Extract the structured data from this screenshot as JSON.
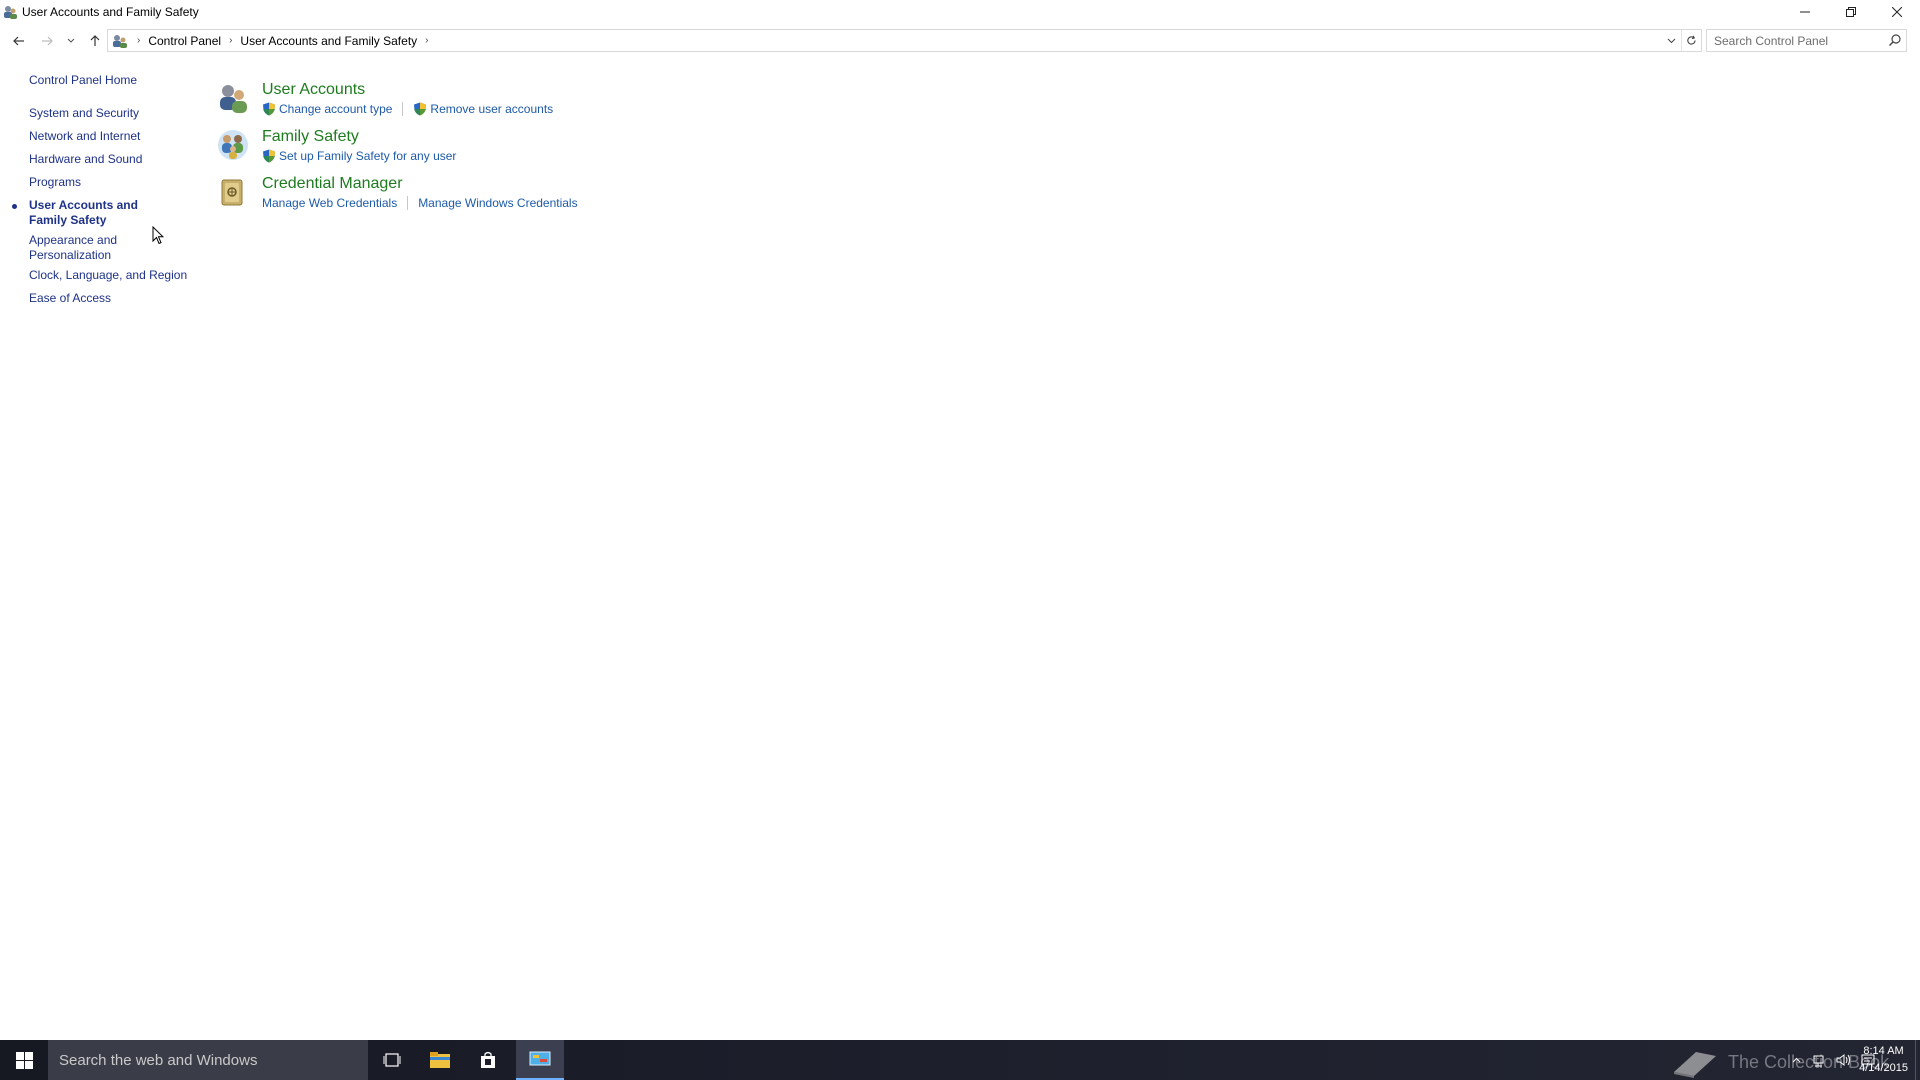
{
  "window": {
    "title": "User Accounts and Family Safety"
  },
  "address": {
    "crumbs": [
      "Control Panel",
      "User Accounts and Family Safety"
    ],
    "search_placeholder": "Search Control Panel"
  },
  "leftnav": {
    "home": "Control Panel Home",
    "items": [
      {
        "label": "System and Security"
      },
      {
        "label": "Network and Internet"
      },
      {
        "label": "Hardware and Sound"
      },
      {
        "label": "Programs"
      },
      {
        "label": "User Accounts and Family Safety",
        "active": true
      },
      {
        "label": "Appearance and Personalization"
      },
      {
        "label": "Clock, Language, and Region"
      },
      {
        "label": "Ease of Access"
      }
    ]
  },
  "categories": [
    {
      "title": "User Accounts",
      "icon": "users-icon",
      "links": [
        {
          "label": "Change account type",
          "shield": true
        },
        {
          "label": "Remove user accounts",
          "shield": true
        }
      ]
    },
    {
      "title": "Family Safety",
      "icon": "family-icon",
      "links": [
        {
          "label": "Set up Family Safety for any user",
          "shield": true
        }
      ]
    },
    {
      "title": "Credential Manager",
      "icon": "vault-icon",
      "links": [
        {
          "label": "Manage Web Credentials",
          "shield": false
        },
        {
          "label": "Manage Windows Credentials",
          "shield": false
        }
      ]
    }
  ],
  "taskbar": {
    "search_placeholder": "Search the web and Windows",
    "watermark": "The Collection Book",
    "time": "8:14 AM",
    "date": "4/14/2015"
  },
  "colors": {
    "link_blue": "#1e5aa8",
    "nav_blue": "#1e3287",
    "category_green": "#1e7b1e",
    "taskbar": "#1d202c"
  }
}
